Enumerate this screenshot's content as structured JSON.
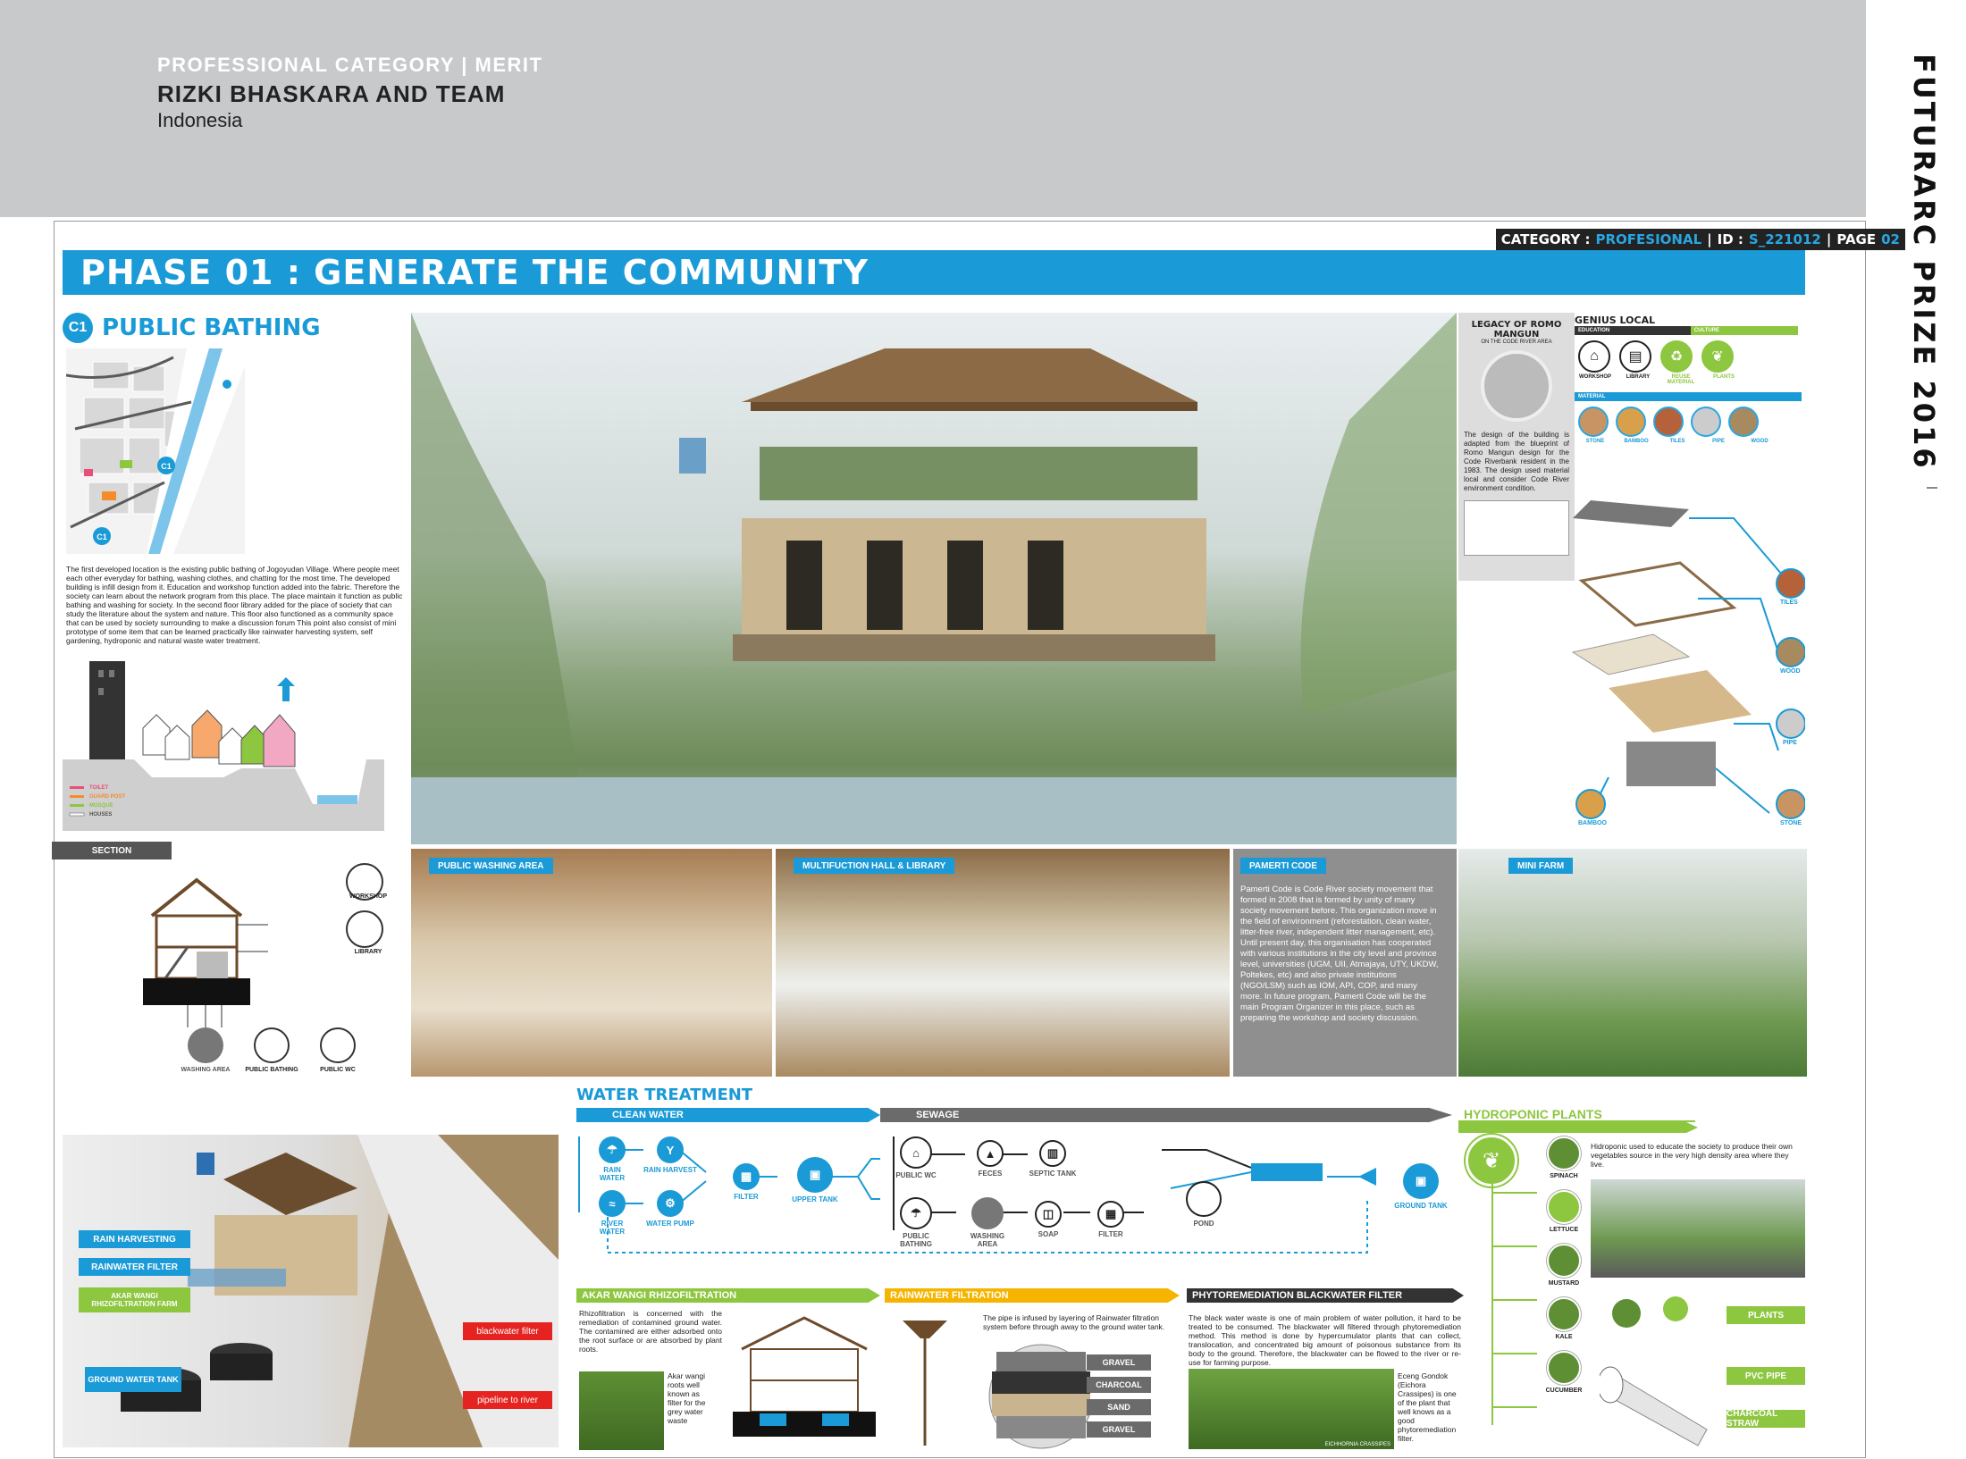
{
  "header": {
    "category_line_a": "PROFESSIONAL CATEGORY | ",
    "category_line_b": "MERIT",
    "team": "RIZKI BHASKARA AND TEAM",
    "country": "Indonesia"
  },
  "side_title": "FUTURARC PRIZE 2016",
  "catbar": {
    "label": "CATEGORY :",
    "value": "PROFESIONAL",
    "id_label": "ID :",
    "id_value": "S_221012",
    "page_label": "PAGE",
    "page_value": "02"
  },
  "phase_title": "PHASE 01 : GENERATE THE COMMUNITY",
  "c1": {
    "badge": "C1",
    "title": "PUBLIC BATHING"
  },
  "map_labels": [
    "C1",
    "C1"
  ],
  "intro_text": "The first developed location is the existing public bathing of Jogoyudan Village. Where people meet each other everyday for bathing, washing clothes, and chatting for the most time. The developed building is infill design from it. Education and workshop function added into the fabric. Therefore the society can learn about the network program from this place. The place maintain it function as public bathing and washing for society. In the second floor library added for the place of society that can study the literature about the system and nature. This floor also functioned as a community space that can be used by society surrounding to make a discussion forum This point also consist of mini prototype of some item that can be learned practically like rainwater harvesting system, self gardening, hydroponic and natural waste water treatment.",
  "legend": [
    "TOILET",
    "GUARD POST",
    "MOSQUE",
    "HOUSES"
  ],
  "section_label": "SECTION",
  "section_icons": [
    "WORKSHOP",
    "LIBRARY"
  ],
  "section_bottom": [
    "WASHING AREA",
    "PUBLIC BATHING",
    "PUBLIC WC"
  ],
  "legacy": {
    "title": "LEGACY OF ROMO MANGUN",
    "subtitle": "ON THE CODE RIVER AREA",
    "text": "The design of the building is adapted from the blueprint of Romo Mangun design for the Code Riverbank resident in the 1983. The design used material local and consider Code River environment condition."
  },
  "genius": {
    "title": "GENIUS LOCAL",
    "bar_education": "EDUCATION",
    "bar_culture": "CULTURE",
    "icons": [
      "WORKSHOP",
      "LIBRARY",
      "REUSE MATERIAL",
      "PLANTS"
    ],
    "bar_material": "MATERIAL",
    "materials": [
      "STONE",
      "BAMBOO",
      "TILES",
      "PIPE",
      "WOOD"
    ]
  },
  "exploded_labels": [
    "TILES",
    "WOOD",
    "PIPE",
    "BAMBOO",
    "STONE"
  ],
  "photos": {
    "washing": "PUBLIC WASHING AREA",
    "hall": "MULTIFUCTION HALL & LIBRARY",
    "pamerti_title": "PAMERTI CODE",
    "pamerti_text": "Pamerti Code is Code River society movement that formed in 2008 that is formed by unity of many society movement before. This organization move in the field of environment (reforestation, clean water, litter-free river, independent litter management, etc). Until present day, this organisation has cooperated with various institutions in the city level and province level, universities (UGM, UII, Atmajaya, UTY, UKDW, Poltekes, etc) and also private institutions (NGO/LSM) such as IOM, API, COP, and many more. In future program, Pamerti Code will be the main Program Organizer in this place, such as preparing the workshop and society discussion.",
    "farm": "MINI FARM"
  },
  "aerial_tags": [
    "RAIN HARVESTING",
    "RAINWATER FILTER",
    "AKAR WANGI RHIZOFILTRATION FARM",
    "GROUND WATER TANK",
    "blackwater filter",
    "pipeline to river"
  ],
  "water": {
    "title": "WATER TREATMENT",
    "clean": "CLEAN WATER",
    "sewage": "SEWAGE",
    "nodes": {
      "rain_water": "RAIN WATER",
      "rain_harvest": "RAIN HARVEST",
      "river_water": "RIVER WATER",
      "water_pump": "WATER PUMP",
      "filter": "FILTER",
      "upper_tank": "UPPER TANK",
      "public_wc": "PUBLIC WC",
      "feces": "FECES",
      "septic_tank": "SEPTIC TANK",
      "public_bathing": "PUBLIC BATHING",
      "washing_area": "WASHING AREA",
      "soap": "SOAP",
      "filter2": "FILTER",
      "pond": "POND",
      "ground_tank": "GROUND TANK"
    }
  },
  "hydro": {
    "title": "HYDROPONIC PLANTS",
    "text": "Hidroponic used to educate the society to produce their own vegetables source in the very high density area where they live.",
    "plants": [
      "SPINACH",
      "LETTUCE",
      "MUSTARD",
      "KALE",
      "CUCUMBER"
    ],
    "tags": [
      "PLANTS",
      "PVC PIPE",
      "CHARCOAL STRAW"
    ]
  },
  "akar": {
    "title": "AKAR WANGI RHIZOFILTRATION",
    "text": "Rhizofiltration is concerned with the remediation of contamined ground water. The contamined are either adsorbed onto the root surface or are absorbed by plant roots.",
    "text2": "Akar wangi roots well known as filter for the grey water waste"
  },
  "rain": {
    "title": "RAINWATER FILTRATION",
    "text": "The pipe is infused by layering of Rainwater filtration system before through away to the ground water tank.",
    "layers": [
      "GRAVEL",
      "CHARCOAL",
      "SAND",
      "GRAVEL"
    ]
  },
  "phyto": {
    "title": "PHYTOREMEDIATION BLACKWATER FILTER",
    "text": "The black water waste is one of main problem of water pollution, it hard to be treated to be consumed. The blackwater will filtered through phytoremediation method. This method is done by hypercumulator plants that can collect, translocation, and concentrated big amount of poisonous substance from its body to the ground. Therefore, the blackwater can be flowed to the river or re-use for farming purpose.",
    "text2": "Eceng Gondok (Eichora Crassipes) is one of the plant that well knows as a good phytoremediation filter.",
    "caption": "EICHHORNIA CRASSIPES"
  },
  "colors": {
    "blue": "#1a9ad6",
    "green": "#8dc63f",
    "yellow": "#f5b400",
    "dark": "#333333",
    "red": "#e52421"
  }
}
